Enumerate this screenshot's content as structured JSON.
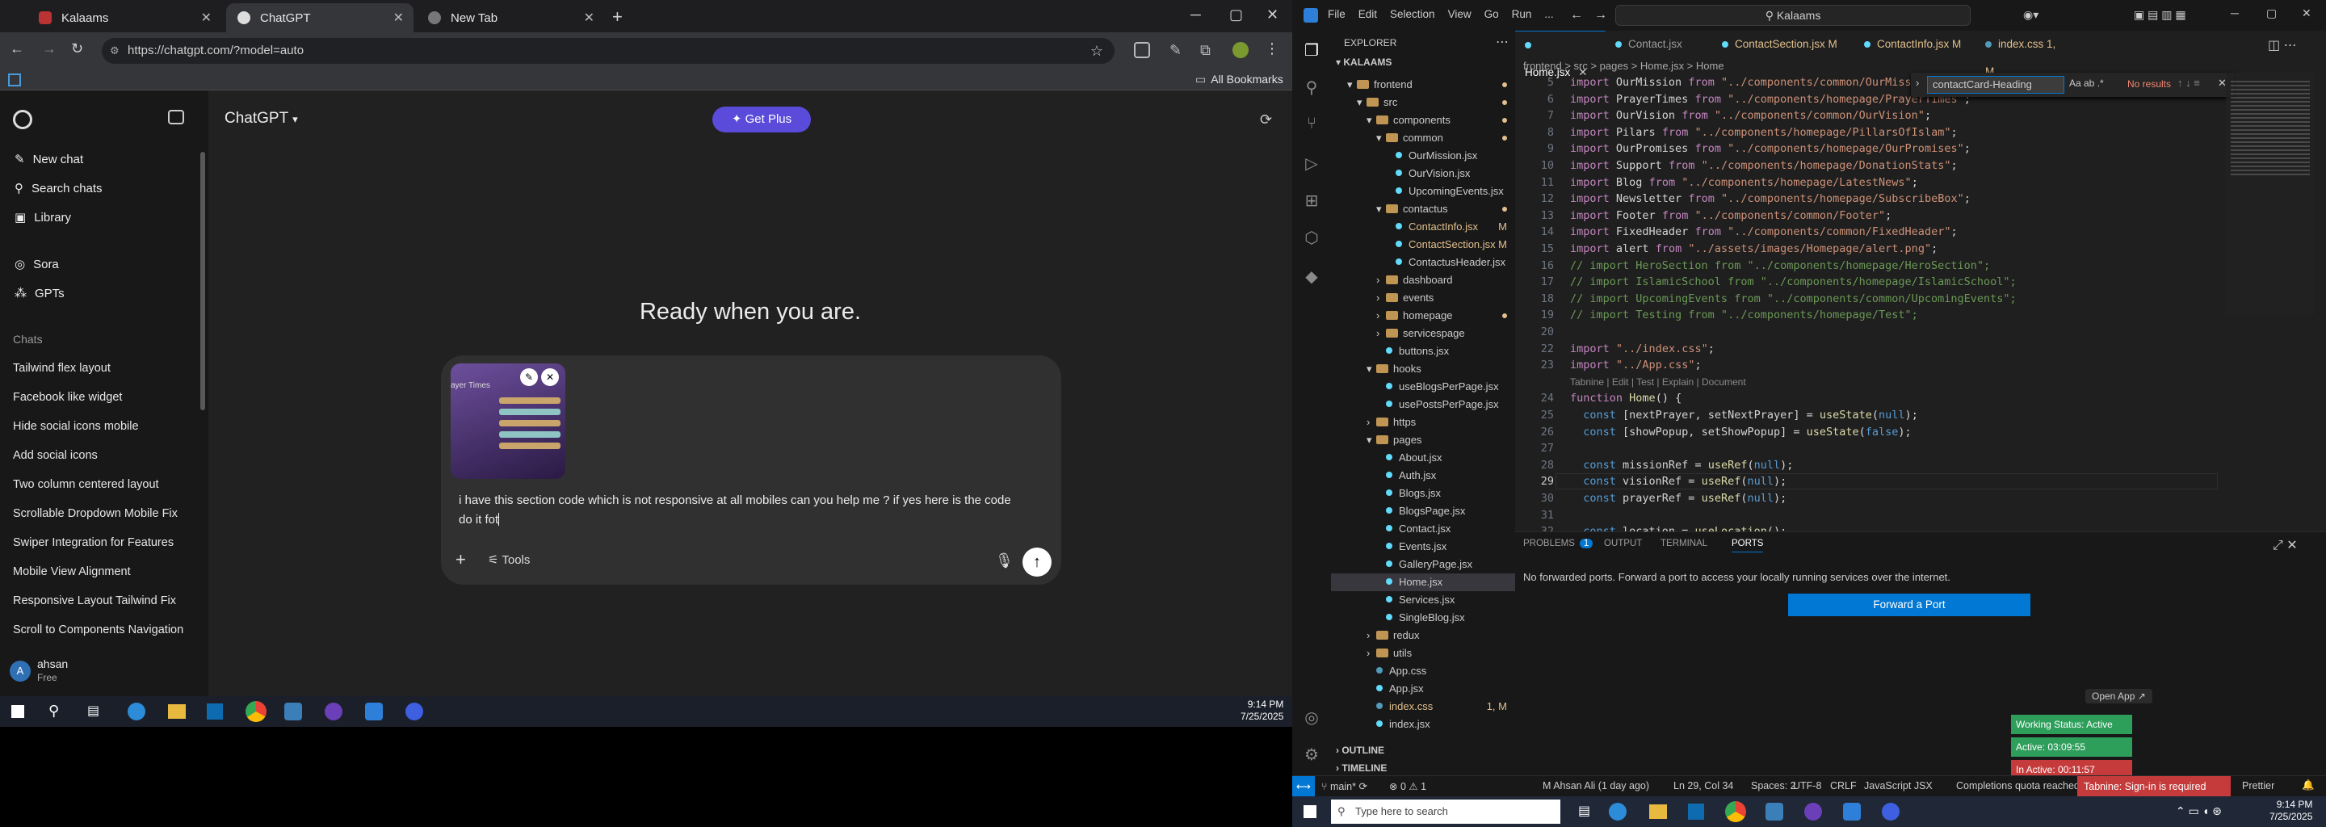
{
  "browser": {
    "tabs": [
      {
        "title": "Kalaams"
      },
      {
        "title": "ChatGPT"
      },
      {
        "title": "New Tab"
      }
    ],
    "url": "https://chatgpt.com/?model=auto",
    "all_bookmarks": "All Bookmarks"
  },
  "sidebar": {
    "top_items": [
      {
        "label": "New chat",
        "icon": "pencil-icon"
      },
      {
        "label": "Search chats",
        "icon": "search-icon"
      },
      {
        "label": "Library",
        "icon": "library-icon"
      }
    ],
    "app_items": [
      {
        "label": "Sora",
        "icon": "sora-icon"
      },
      {
        "label": "GPTs",
        "icon": "grid-icon"
      }
    ],
    "section_title": "Chats",
    "chats": [
      "Tailwind flex layout",
      "Facebook like widget",
      "Hide social icons mobile",
      "Add social icons",
      "Two column centered layout",
      "Scrollable Dropdown Mobile Fix",
      "Swiper Integration for Features",
      "Mobile View Alignment",
      "Responsive Layout Tailwind Fix",
      "Scroll to Components Navigation"
    ],
    "user": {
      "initial": "A",
      "name": "ahsan",
      "plan": "Free"
    }
  },
  "chat": {
    "model": "ChatGPT",
    "get_plus": "Get Plus",
    "heading": "Ready when you are.",
    "prompt_line1": "i have this section code which is not responsive at all mobiles can you help me ? if yes here is the code",
    "prompt_line2": "do it fot",
    "tools": "Tools",
    "thumb_text": "ayer Times"
  },
  "taskbar_left": {
    "time": "9:14 PM",
    "date": "7/25/2025"
  },
  "vscode": {
    "search": "Kalaams",
    "menu": [
      "File",
      "Edit",
      "Selection",
      "View",
      "Go",
      "Run",
      "..."
    ],
    "explorer_title": "EXPLORER",
    "root": "KALAAMS",
    "tree": [
      {
        "name": "frontend",
        "type": "folder",
        "depth": 1,
        "open": true,
        "dot": true
      },
      {
        "name": "src",
        "type": "folder",
        "depth": 2,
        "open": true,
        "dot": true
      },
      {
        "name": "components",
        "type": "folder",
        "depth": 3,
        "open": true,
        "dot": true
      },
      {
        "name": "common",
        "type": "folder",
        "depth": 4,
        "open": true,
        "dot": true
      },
      {
        "name": "OurMission.jsx",
        "type": "file",
        "depth": 5
      },
      {
        "name": "OurVision.jsx",
        "type": "file",
        "depth": 5
      },
      {
        "name": "UpcomingEvents.jsx",
        "type": "file",
        "depth": 5
      },
      {
        "name": "contactus",
        "type": "folder",
        "depth": 4,
        "open": true,
        "dot": true
      },
      {
        "name": "ContactInfo.jsx",
        "type": "file",
        "depth": 5,
        "mod": "M"
      },
      {
        "name": "ContactSection.jsx",
        "type": "file",
        "depth": 5,
        "mod": "M"
      },
      {
        "name": "ContactusHeader.jsx",
        "type": "file",
        "depth": 5
      },
      {
        "name": "dashboard",
        "type": "folder",
        "depth": 4
      },
      {
        "name": "events",
        "type": "folder",
        "depth": 4
      },
      {
        "name": "homepage",
        "type": "folder",
        "depth": 4,
        "dot": true
      },
      {
        "name": "servicespage",
        "type": "folder",
        "depth": 4
      },
      {
        "name": "buttons.jsx",
        "type": "file",
        "depth": 4
      },
      {
        "name": "hooks",
        "type": "folder",
        "depth": 3,
        "open": true
      },
      {
        "name": "useBlogsPerPage.jsx",
        "type": "file",
        "depth": 4
      },
      {
        "name": "usePostsPerPage.jsx",
        "type": "file",
        "depth": 4
      },
      {
        "name": "https",
        "type": "folder",
        "depth": 3
      },
      {
        "name": "pages",
        "type": "folder",
        "depth": 3,
        "open": true
      },
      {
        "name": "About.jsx",
        "type": "file",
        "depth": 4
      },
      {
        "name": "Auth.jsx",
        "type": "file",
        "depth": 4
      },
      {
        "name": "Blogs.jsx",
        "type": "file",
        "depth": 4
      },
      {
        "name": "BlogsPage.jsx",
        "type": "file",
        "depth": 4
      },
      {
        "name": "Contact.jsx",
        "type": "file",
        "depth": 4
      },
      {
        "name": "Events.jsx",
        "type": "file",
        "depth": 4
      },
      {
        "name": "GalleryPage.jsx",
        "type": "file",
        "depth": 4
      },
      {
        "name": "Home.jsx",
        "type": "file",
        "depth": 4,
        "selected": true
      },
      {
        "name": "Services.jsx",
        "type": "file",
        "depth": 4
      },
      {
        "name": "SingleBlog.jsx",
        "type": "file",
        "depth": 4
      },
      {
        "name": "redux",
        "type": "folder",
        "depth": 3
      },
      {
        "name": "utils",
        "type": "folder",
        "depth": 3
      },
      {
        "name": "App.css",
        "type": "file",
        "depth": 3
      },
      {
        "name": "App.jsx",
        "type": "file",
        "depth": 3
      },
      {
        "name": "index.css",
        "type": "file",
        "depth": 3,
        "mod": "1, M"
      },
      {
        "name": "index.jsx",
        "type": "file",
        "depth": 3
      }
    ],
    "outline": "OUTLINE",
    "timeline": "TIMELINE",
    "tabs": [
      {
        "name": "Home.jsx",
        "active": true
      },
      {
        "name": "Contact.jsx"
      },
      {
        "name": "ContactSection.jsx M"
      },
      {
        "name": "ContactInfo.jsx M"
      },
      {
        "name": "index.css 1, M"
      }
    ],
    "breadcrumb": "frontend > src > pages > Home.jsx > Home",
    "find": {
      "query": "contactCard-Heading",
      "result": "No results"
    },
    "code_lines": [
      {
        "n": "5",
        "t": "import OurMission from \"../components/common/OurMission\";"
      },
      {
        "n": "6",
        "t": "import PrayerTimes from \"../components/homepage/PrayerTimes\";"
      },
      {
        "n": "7",
        "t": "import OurVision from \"../components/common/OurVision\";"
      },
      {
        "n": "8",
        "t": "import Pilars from \"../components/homepage/PillarsOfIslam\";"
      },
      {
        "n": "9",
        "t": "import OurPromises from \"../components/homepage/OurPromises\";"
      },
      {
        "n": "10",
        "t": "import Support from \"../components/homepage/DonationStats\";"
      },
      {
        "n": "11",
        "t": "import Blog from \"../components/homepage/LatestNews\";"
      },
      {
        "n": "12",
        "t": "import Newsletter from \"../components/homepage/SubscribeBox\";"
      },
      {
        "n": "13",
        "t": "import Footer from \"../components/common/Footer\";"
      },
      {
        "n": "14",
        "t": "import FixedHeader from \"../components/common/FixedHeader\";"
      },
      {
        "n": "15",
        "t": "import alert from \"../assets/images/Homepage/alert.png\";"
      },
      {
        "n": "16",
        "t": "// import HeroSection from \"../components/homepage/HeroSection\";"
      },
      {
        "n": "17",
        "t": "// import IslamicSchool from \"../components/homepage/IslamicSchool\";"
      },
      {
        "n": "18",
        "t": "// import UpcomingEvents from \"../components/common/UpcomingEvents\";"
      },
      {
        "n": "19",
        "t": "// import Testing from \"../components/homepage/Test\";"
      },
      {
        "n": "20",
        "t": ""
      },
      {
        "n": "22",
        "t": "import \"../index.css\";"
      },
      {
        "n": "23",
        "t": "import \"../App.css\";"
      },
      {
        "n": "",
        "t": "Tabnine | Edit | Test | Explain | Document"
      },
      {
        "n": "24",
        "t": "function Home() {"
      },
      {
        "n": "25",
        "t": "  const [nextPrayer, setNextPrayer] = useState(null);"
      },
      {
        "n": "26",
        "t": "  const [showPopup, setShowPopup] = useState(false);"
      },
      {
        "n": "27",
        "t": ""
      },
      {
        "n": "28",
        "t": "  const missionRef = useRef(null);"
      },
      {
        "n": "29",
        "t": "  const visionRef = useRef(null);"
      },
      {
        "n": "30",
        "t": "  const prayerRef = useRef(null);"
      },
      {
        "n": "31",
        "t": ""
      },
      {
        "n": "32",
        "t": "  const location = useLocation();"
      }
    ],
    "panel_tabs": [
      "PROBLEMS",
      "OUTPUT",
      "TERMINAL",
      "PORTS"
    ],
    "problems_count": "1",
    "ports_message": "No forwarded ports. Forward a port to access your locally running services over the internet.",
    "forward_button": "Forward a Port",
    "widget": {
      "open_app": "Open App",
      "working": "Working Status: Active",
      "active": "Active: 03:09:55",
      "inactive": "In Active: 00:11:57"
    },
    "status": {
      "branch": "main*",
      "errors": "0",
      "warnings": "1",
      "author": "M Ahsan Ali (1 day ago)",
      "pos": "Ln 29, Col 34",
      "spaces": "Spaces: 2",
      "enc": "UTF-8",
      "eol": "CRLF",
      "lang": "JavaScript JSX",
      "quota": "Completions quota reached",
      "tabnine": "Tabnine: Sign-in is required",
      "prettier": "Prettier"
    }
  },
  "taskbar_right": {
    "search": "Type here to search",
    "time": "9:14 PM",
    "date": "7/25/2025"
  },
  "colors": {
    "accent": "#0078d4",
    "plus": "#5b4bdb",
    "widget_green": "#2e9e5b",
    "widget_red": "#c53b3b"
  }
}
